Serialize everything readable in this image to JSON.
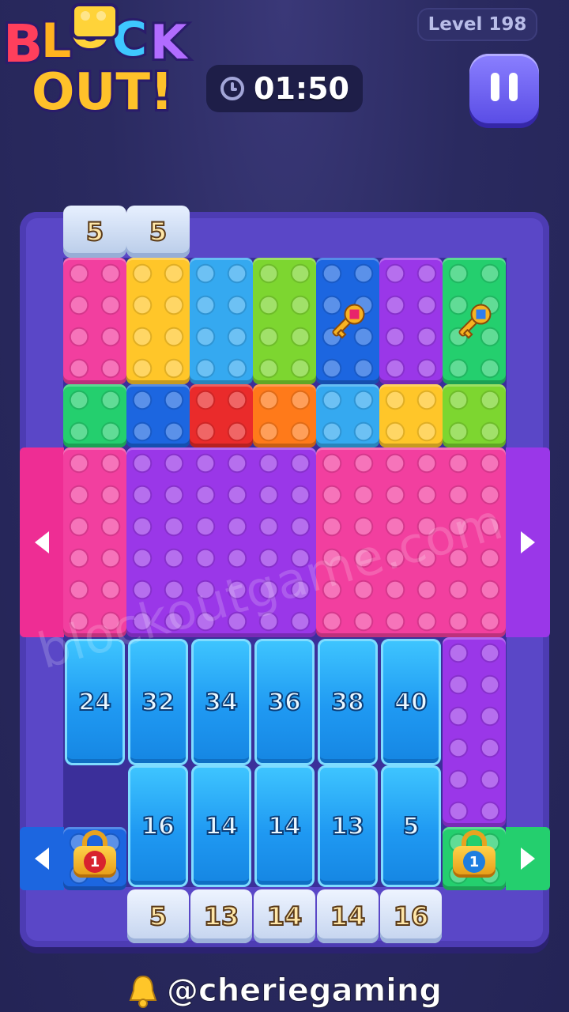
{
  "header": {
    "logo_line1": "BLOCK",
    "logo_line2": "OUT!",
    "level_label": "Level 198",
    "timer": "01:50"
  },
  "board": {
    "top_exit_values": [
      "5",
      "5"
    ],
    "bottom_exit_values": [
      "5",
      "13",
      "14",
      "14",
      "16"
    ],
    "ice_row1": [
      "24",
      "32",
      "34",
      "36",
      "38",
      "40"
    ],
    "ice_row2": [
      "16",
      "14",
      "14",
      "13",
      "5"
    ],
    "locks": [
      {
        "value": "1",
        "color": "#d8232e"
      },
      {
        "value": "1",
        "color": "#1e7ee0"
      }
    ]
  },
  "colors": {
    "pink": "#f23f9f",
    "yellow": "#ffc629",
    "sky": "#35a9f0",
    "lime": "#7dd630",
    "blue": "#1c66e0",
    "purple": "#9a37e8",
    "green": "#24cf6e",
    "red": "#ea2b2b",
    "orange": "#ff7a1a"
  },
  "watermark": "blockoutgame.com",
  "footer": {
    "handle": "@cheriegaming"
  }
}
